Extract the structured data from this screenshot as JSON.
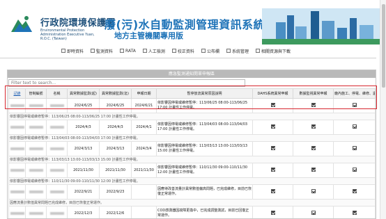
{
  "header": {
    "agency": "行政院環境保護署",
    "agency_en": "Environmental Protection Administration Executive Yuan, R.O.C. (Taiwan)",
    "title": "廢(污)水自動監測管理資訊系統",
    "subtitle": "地方主管機關專用版"
  },
  "nav": [
    "即時資料",
    "監測資料",
    "RATA",
    "人工檢測",
    "校正資料",
    "公布欄",
    "系統管理",
    "相關資源與下載"
  ],
  "page": {
    "title": "應急監測通知開單申報區",
    "search_placeholder": "Filter text to search..."
  },
  "table": {
    "headers": [
      "記錄",
      "管制編號",
      "名稱",
      "異常數據監測(起)",
      "異常數據監測(迄)",
      "申報日期",
      "暫停放流異常原因說明",
      "DAHS系統異常申報",
      "數據監視異常申報",
      "廠內施工、停電、維修、遺缺通報"
    ],
    "rows": [
      {
        "start": "2024/6/25",
        "end": "2024/6/25",
        "date": "2024/6/21",
        "reason": "依影響因停電或維修暫停：113/06/25 08:00-113/06/25 17:00 計畫性工作停電。",
        "checks": [
          "on",
          "on",
          "tick"
        ],
        "note": "依影響因停電或維修暫停：113/06/25 08:00-113/06/25 17:00 計畫性工作停電。"
      },
      {
        "start": "2024/4/3",
        "end": "2024/4/3",
        "date": "2024/4/1",
        "reason": "依影響因停電或維修暫停：113/04/03 08:00-113/04/03 17:00 計畫性工作停電。",
        "checks": [
          "on",
          "on",
          "tick"
        ],
        "note": "依影響因停電或維修暫停：113/04/03 08:00-113/04/03 17:00 計畫性工作停電。"
      },
      {
        "start": "2024/3/13",
        "end": "2024/3/13",
        "date": "2024/3/4",
        "reason": "依影響因停電或維修暫停：113/03/13 13:00-113/03/13 15:00 計畫性工作停電。",
        "checks": [
          "on",
          "on",
          "tick"
        ],
        "note": "依影響因停電或維修暫停：113/03/13 13:00-113/03/13 15:00 計畫性工作停電。"
      },
      {
        "start": "2021/11/30",
        "end": "2021/11/30",
        "date": "2021/11/30",
        "reason": "依影響因停電或維修暫停：110/11/30 09:00-110/11/30 12:00 計畫性工作停電。",
        "checks": [
          "on",
          "on",
          "tick"
        ],
        "note": "依影響因停電或維修暫停：110/11/30 09:00-110/11/30 12:00 計畫性工作停電。"
      },
      {
        "start": "2022/9/21",
        "end": "2022/9/23",
        "date": "",
        "reason": "因應待改善流量計異常數值偏高問題，已完成維修，目前已恢復正常運作。",
        "checks": [
          "on",
          "tick",
          "on"
        ],
        "note": "因應流量計數值異常問題已完成維修，目前已恢復正常運作。"
      },
      {
        "start": "2022/12/3",
        "end": "2022/12/6",
        "date": "",
        "reason": "COD感測器因故障更換中，已完成調整測試，目前已回復正常運作。",
        "checks": [
          "on",
          "tick",
          "on"
        ],
        "note": ""
      }
    ]
  }
}
